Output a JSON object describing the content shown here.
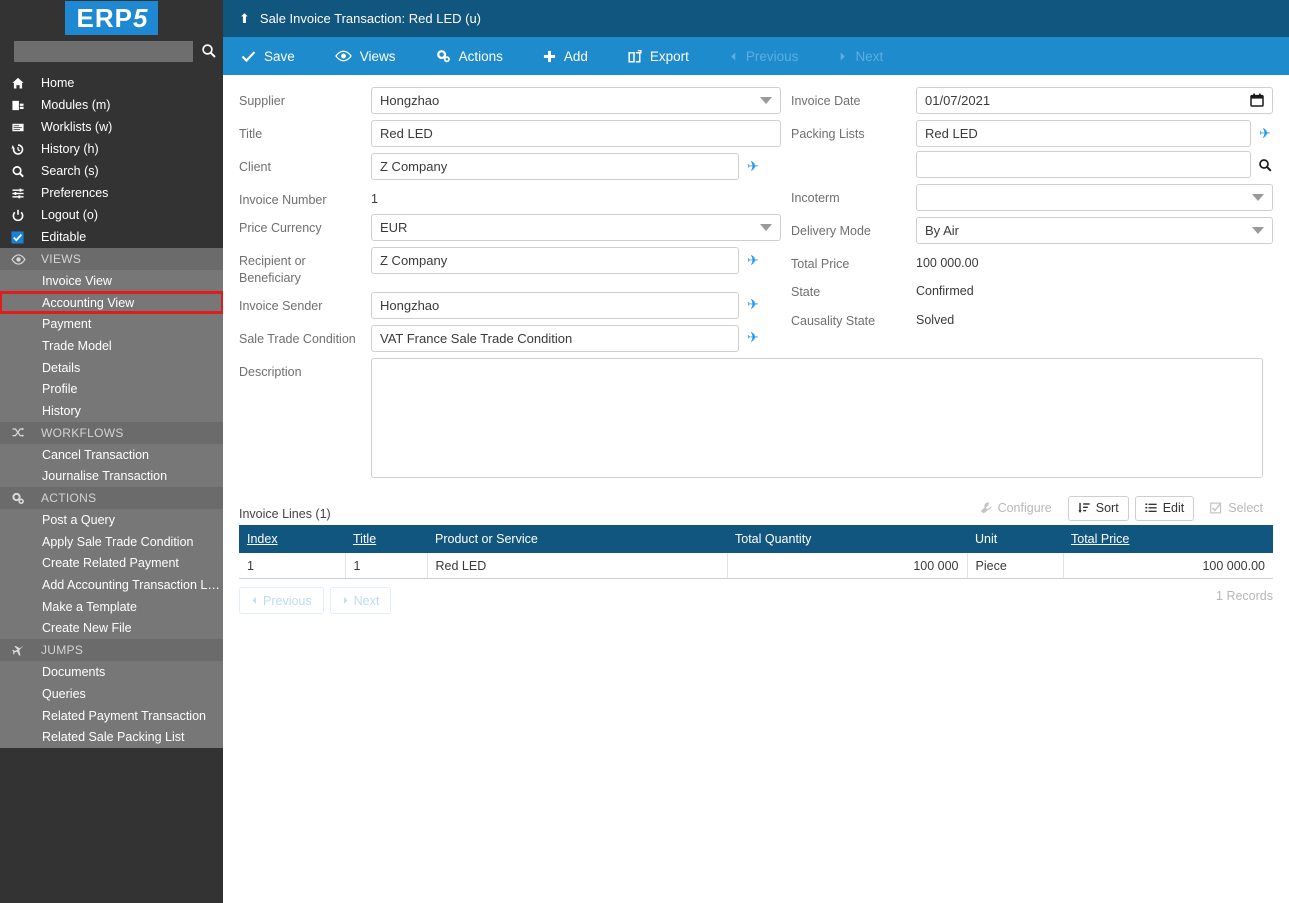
{
  "brand": {
    "logo_text_main": "ERP",
    "logo_text_accent": "5",
    "accent_color": "#1e88d2"
  },
  "sidebar": {
    "search_placeholder": "",
    "search_value": "",
    "main_items": [
      {
        "icon": "home-icon",
        "label": "Home"
      },
      {
        "icon": "modules-icon",
        "label": "Modules (m)"
      },
      {
        "icon": "worklists-icon",
        "label": "Worklists (w)"
      },
      {
        "icon": "history-icon",
        "label": "History (h)"
      },
      {
        "icon": "search-icon",
        "label": "Search (s)"
      },
      {
        "icon": "preferences-icon",
        "label": "Preferences"
      },
      {
        "icon": "logout-icon",
        "label": "Logout (o)"
      },
      {
        "icon": "checkbox-checked-icon",
        "label": "Editable"
      }
    ],
    "sections": [
      {
        "icon": "eye-icon",
        "title": "VIEWS",
        "items": [
          {
            "label": "Invoice View",
            "highlighted": false
          },
          {
            "label": "Accounting View",
            "highlighted": true
          },
          {
            "label": "Payment",
            "highlighted": false
          },
          {
            "label": "Trade Model",
            "highlighted": false
          },
          {
            "label": "Details",
            "highlighted": false
          },
          {
            "label": "Profile",
            "highlighted": false
          },
          {
            "label": "History",
            "highlighted": false
          }
        ]
      },
      {
        "icon": "workflows-icon",
        "title": "WORKFLOWS",
        "items": [
          {
            "label": "Cancel Transaction",
            "highlighted": false
          },
          {
            "label": "Journalise Transaction",
            "highlighted": false
          }
        ]
      },
      {
        "icon": "gears-icon",
        "title": "ACTIONS",
        "items": [
          {
            "label": "Post a Query",
            "highlighted": false
          },
          {
            "label": "Apply Sale Trade Condition",
            "highlighted": false
          },
          {
            "label": "Create Related Payment",
            "highlighted": false
          },
          {
            "label": "Add Accounting Transaction L…",
            "highlighted": false
          },
          {
            "label": "Make a Template",
            "highlighted": false
          },
          {
            "label": "Create New File",
            "highlighted": false
          }
        ]
      },
      {
        "icon": "jumps-icon",
        "title": "JUMPS",
        "items": [
          {
            "label": "Documents",
            "highlighted": false
          },
          {
            "label": "Queries",
            "highlighted": false
          },
          {
            "label": "Related Payment Transaction",
            "highlighted": false
          },
          {
            "label": "Related Sale Packing List",
            "highlighted": false
          }
        ]
      }
    ]
  },
  "header": {
    "title": "Sale Invoice Transaction: Red LED (u)",
    "bar_color": "#11567f"
  },
  "toolbar": {
    "bar_color": "#1e8bcd",
    "buttons": [
      {
        "icon": "check-icon",
        "label": "Save",
        "disabled": false
      },
      {
        "icon": "eye-icon",
        "label": "Views",
        "disabled": false
      },
      {
        "icon": "gears-icon",
        "label": "Actions",
        "disabled": false
      },
      {
        "icon": "plus-icon",
        "label": "Add",
        "disabled": false
      },
      {
        "icon": "export-icon",
        "label": "Export",
        "disabled": false
      },
      {
        "icon": "prev-icon",
        "label": "Previous",
        "disabled": true
      },
      {
        "icon": "next-icon",
        "label": "Next",
        "disabled": true
      }
    ]
  },
  "form": {
    "left": {
      "supplier": {
        "label": "Supplier",
        "value": "Hongzhao",
        "type": "select"
      },
      "title": {
        "label": "Title",
        "value": "Red LED",
        "type": "text"
      },
      "client": {
        "label": "Client",
        "value": "Z Company",
        "type": "relation"
      },
      "invoice_number": {
        "label": "Invoice Number",
        "value": "1",
        "type": "readonly"
      },
      "price_currency": {
        "label": "Price Currency",
        "value": "EUR",
        "type": "select"
      },
      "recipient": {
        "label": "Recipient or Beneficiary",
        "label_line1": "Recipient or",
        "label_line2": "Beneficiary",
        "value": "Z Company",
        "type": "relation"
      },
      "invoice_sender": {
        "label": "Invoice Sender",
        "value": "Hongzhao",
        "type": "relation"
      },
      "trade_condition": {
        "label": "Sale Trade Condition",
        "value": "VAT France Sale Trade Condition",
        "type": "relation"
      },
      "description": {
        "label": "Description",
        "value": "",
        "type": "textarea"
      }
    },
    "right": {
      "invoice_date": {
        "label": "Invoice Date",
        "value": "01/07/2021",
        "type": "date"
      },
      "packing_lists": {
        "label": "Packing Lists",
        "value": "Red LED",
        "value2": "",
        "type": "relation-multi"
      },
      "incoterm": {
        "label": "Incoterm",
        "value": "",
        "type": "select"
      },
      "delivery_mode": {
        "label": "Delivery Mode",
        "value": "By Air",
        "type": "select"
      },
      "total_price": {
        "label": "Total Price",
        "value": "100 000.00",
        "type": "readonly"
      },
      "state": {
        "label": "State",
        "value": "Confirmed",
        "type": "readonly"
      },
      "causality_state": {
        "label": "Causality State",
        "value": "Solved",
        "type": "readonly"
      }
    }
  },
  "listbox": {
    "title": "Invoice Lines (1)",
    "buttons": [
      {
        "icon": "wrench-icon",
        "label": "Configure",
        "disabled": true
      },
      {
        "icon": "sort-icon",
        "label": "Sort",
        "disabled": false
      },
      {
        "icon": "list-icon",
        "label": "Edit",
        "disabled": false
      },
      {
        "icon": "checkbox-icon",
        "label": "Select",
        "disabled": true
      }
    ],
    "columns": [
      {
        "label": "Index",
        "sortable": true,
        "align": "left"
      },
      {
        "label": "Title",
        "sortable": true,
        "align": "left"
      },
      {
        "label": "Product or Service",
        "sortable": false,
        "align": "left"
      },
      {
        "label": "Total Quantity",
        "sortable": false,
        "align": "left"
      },
      {
        "label": "Unit",
        "sortable": false,
        "align": "left"
      },
      {
        "label": "Total Price",
        "sortable": true,
        "align": "left"
      }
    ],
    "rows": [
      {
        "index": "1",
        "title": "1",
        "product": "Red LED",
        "quantity": "100 000",
        "unit": "Piece",
        "total_price": "100 000.00"
      }
    ],
    "pagination": {
      "previous": "Previous",
      "next": "Next"
    },
    "records": "1 Records"
  }
}
